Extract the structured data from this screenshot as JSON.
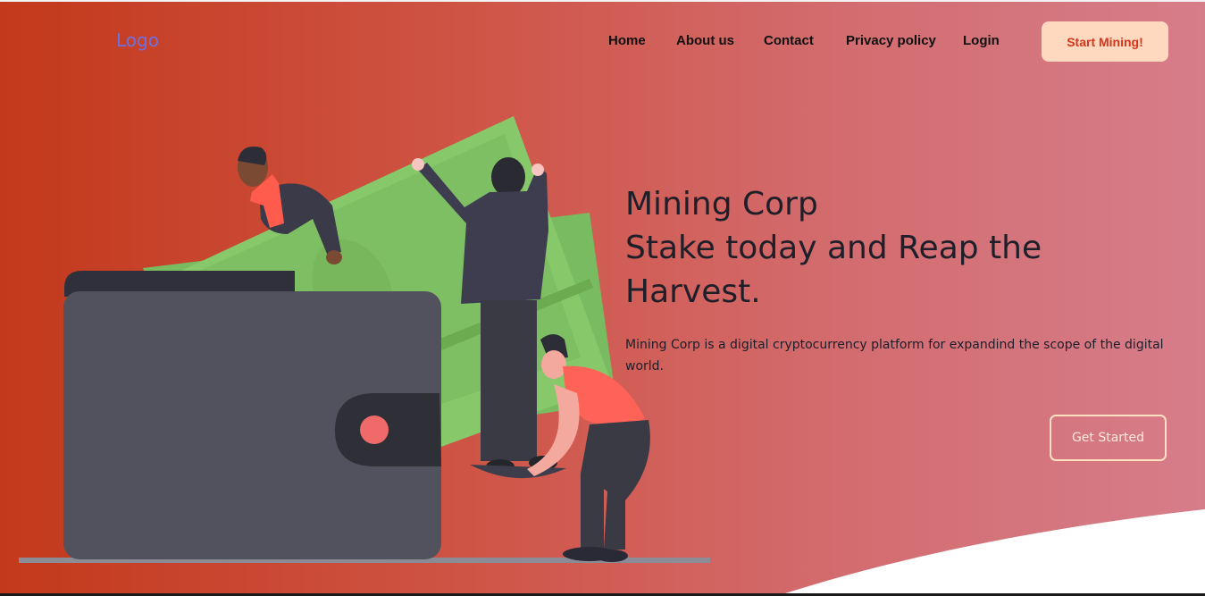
{
  "header": {
    "logo": "Logo",
    "nav": [
      "Home",
      "About us",
      "Contact",
      "Privacy policy",
      "Login"
    ],
    "cta": "Start Mining!"
  },
  "hero": {
    "title_line1": "Mining Corp",
    "title_line2": "Stake today and Reap the Harvest.",
    "description": "Mining Corp is a digital cryptocurrency platform for expandind the scope of the digital world.",
    "button": "Get Started"
  },
  "illustration": {
    "subject": "people-with-wallet-and-money-illustration"
  },
  "colors": {
    "gradient_start": "#c3391b",
    "gradient_end": "#d67d8a",
    "logo": "#6f70e0",
    "cta_bg": "#ffd8c0",
    "cta_text": "#d8341a",
    "heading": "#1f1f29"
  }
}
